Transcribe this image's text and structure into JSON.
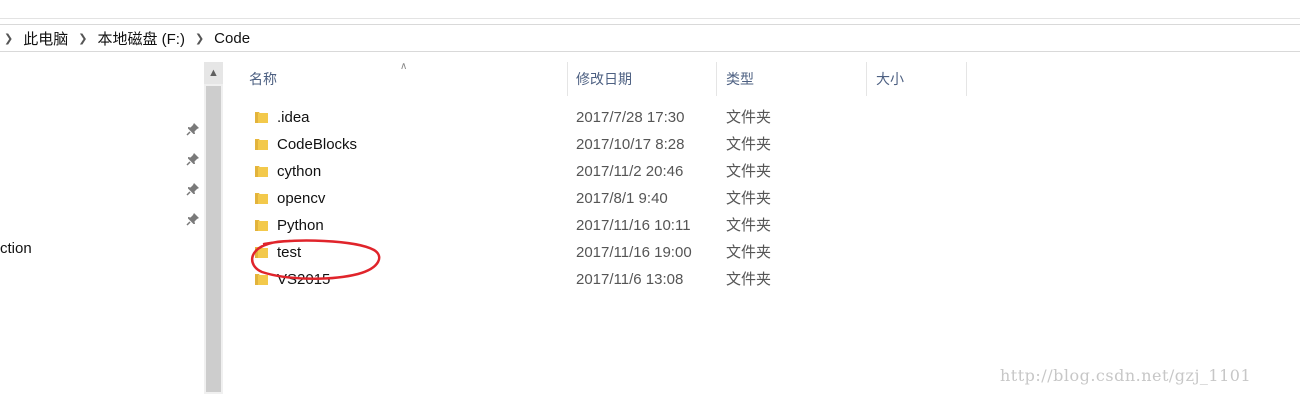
{
  "breadcrumb": [
    "此电脑",
    "本地磁盘 (F:)",
    "Code"
  ],
  "nav": {
    "partial_label": "ction"
  },
  "columns": [
    "名称",
    "修改日期",
    "类型",
    "大小"
  ],
  "files": [
    {
      "name": ".idea",
      "modified": "2017/7/28 17:30",
      "type": "文件夹"
    },
    {
      "name": "CodeBlocks",
      "modified": "2017/10/17 8:28",
      "type": "文件夹"
    },
    {
      "name": "cython",
      "modified": "2017/11/2 20:46",
      "type": "文件夹"
    },
    {
      "name": "opencv",
      "modified": "2017/8/1 9:40",
      "type": "文件夹"
    },
    {
      "name": "Python",
      "modified": "2017/11/16 10:11",
      "type": "文件夹"
    },
    {
      "name": "test",
      "modified": "2017/11/16 19:00",
      "type": "文件夹"
    },
    {
      "name": "VS2015",
      "modified": "2017/11/6 13:08",
      "type": "文件夹"
    }
  ],
  "watermark": "http://blog.csdn.net/gzj_1101",
  "colors": {
    "folder": "#f3c94b",
    "header_text": "#4d6082",
    "annotation": "#e0242b"
  },
  "icons": [
    "pin-icon",
    "folder-icon",
    "chevron-right-icon",
    "sort-up-icon",
    "scroll-up-icon"
  ]
}
